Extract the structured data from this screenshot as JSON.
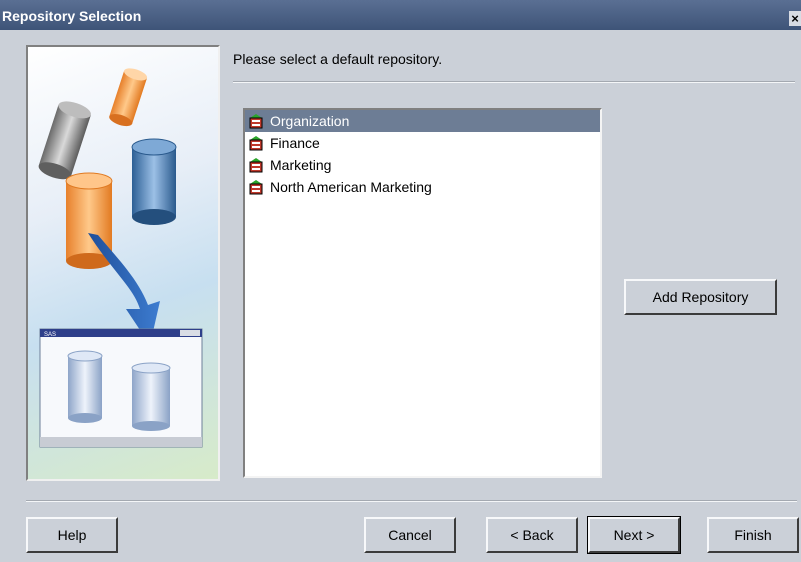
{
  "window": {
    "title": "Repository Selection",
    "close_glyph": "×"
  },
  "prompt": "Please select a default repository.",
  "repositories": [
    {
      "label": "Organization",
      "selected": true,
      "icon": "repository-icon"
    },
    {
      "label": "Finance",
      "selected": false,
      "icon": "repository-icon"
    },
    {
      "label": "Marketing",
      "selected": false,
      "icon": "repository-icon"
    },
    {
      "label": "North American Marketing",
      "selected": false,
      "icon": "repository-icon"
    }
  ],
  "buttons": {
    "add_repository": "Add Repository",
    "help": "Help",
    "cancel": "Cancel",
    "back": "< Back",
    "next": "Next >",
    "finish": "Finish"
  },
  "illustration": {
    "window_label": "SAS"
  },
  "colors": {
    "titlebar": "#4a5f84",
    "selection": "#6d7d95",
    "dialog_bg": "#cbd0d8"
  }
}
